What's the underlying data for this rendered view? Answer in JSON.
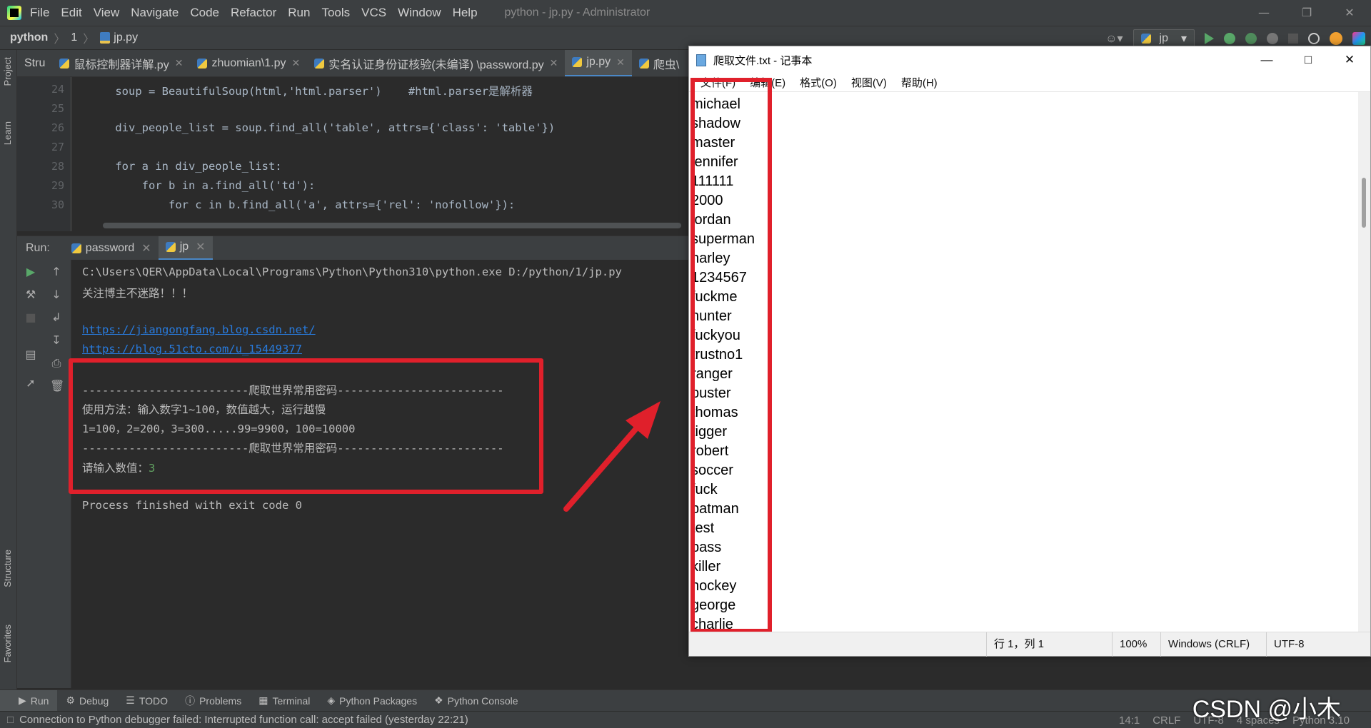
{
  "titlebar": {
    "menu": [
      "File",
      "Edit",
      "View",
      "Navigate",
      "Code",
      "Refactor",
      "Run",
      "Tools",
      "VCS",
      "Window",
      "Help"
    ],
    "title": "python - jp.py - Administrator"
  },
  "navbar": {
    "project": "python",
    "folder": "1",
    "file": "jp.py",
    "run_config": "jp"
  },
  "side_tabs": {
    "project": "Project",
    "learn": "Learn",
    "structure": "Structure",
    "favorites": "Favorites"
  },
  "editor_tabs": [
    {
      "label": "Stru",
      "active": false
    },
    {
      "label": "鼠标控制器详解.py",
      "active": false
    },
    {
      "label": "zhuomian\\1.py",
      "active": false
    },
    {
      "label": "实名认证身份证核验(未编译) \\password.py",
      "active": false
    },
    {
      "label": "jp.py",
      "active": true
    },
    {
      "label": "爬虫\\",
      "active": false
    }
  ],
  "editor": {
    "lines": [
      {
        "num": "24",
        "code": "    soup = BeautifulSoup(html,'html.parser')    #html.parser是解析器"
      },
      {
        "num": "25",
        "code": ""
      },
      {
        "num": "26",
        "code": "    div_people_list = soup.find_all('table', attrs={'class': 'table'})"
      },
      {
        "num": "27",
        "code": ""
      },
      {
        "num": "28",
        "code": "    for a in div_people_list:"
      },
      {
        "num": "29",
        "code": "        for b in a.find_all('td'):"
      },
      {
        "num": "30",
        "code": "            for c in b.find_all('a', attrs={'rel': 'nofollow'}):"
      }
    ]
  },
  "run_panel": {
    "label": "Run:",
    "tabs": [
      "password",
      "jp"
    ],
    "console": [
      "C:\\Users\\QER\\AppData\\Local\\Programs\\Python\\Python310\\python.exe D:/python/1/jp.py",
      "关注博主不迷路！！！",
      "",
      "https://jiangongfang.blog.csdn.net/",
      "https://blog.51cto.com/u_15449377",
      "",
      "-------------------------爬取世界常用密码-------------------------",
      "使用方法：输入数字1~100，数值越大，运行越慢",
      "1=100，2=200，3=300.....99=9900，100=10000",
      "-------------------------爬取世界常用密码-------------------------",
      "请输入数值：",
      "",
      "Process finished with exit code 0"
    ],
    "input_value": "3"
  },
  "bottom_tabs": [
    "Run",
    "Debug",
    "TODO",
    "Problems",
    "Terminal",
    "Python Packages",
    "Python Console"
  ],
  "status": {
    "message": "Connection to Python debugger failed: Interrupted function call: accept failed (yesterday 22:21)",
    "position": "14:1",
    "line_sep": "CRLF",
    "encoding": "UTF-8",
    "indent": "4 spaces",
    "interpreter": "Python 3.10"
  },
  "watermark": "CSDN @小木",
  "notepad": {
    "title": "爬取文件.txt - 记事本",
    "menu": [
      "文件(F)",
      "编辑(E)",
      "格式(O)",
      "视图(V)",
      "帮助(H)"
    ],
    "lines": [
      "michael",
      "shadow",
      "master",
      "jennifer",
      "111111",
      "2000",
      "jordan",
      "superman",
      "harley",
      "1234567",
      "fuckme",
      "hunter",
      "fuckyou",
      "trustno1",
      "ranger",
      "buster",
      "thomas",
      "tigger",
      "robert",
      "soccer",
      "fuck",
      "batman",
      "test",
      "pass",
      "killer",
      "hockey",
      "george",
      "charlie"
    ],
    "status": {
      "cursor": "行 1，列 1",
      "zoom": "100%",
      "line_ending": "Windows (CRLF)",
      "encoding": "UTF-8"
    }
  },
  "colors": {
    "annotation_red": "#e0202b",
    "accent_blue": "#4a88c7",
    "link": "#287bde"
  }
}
